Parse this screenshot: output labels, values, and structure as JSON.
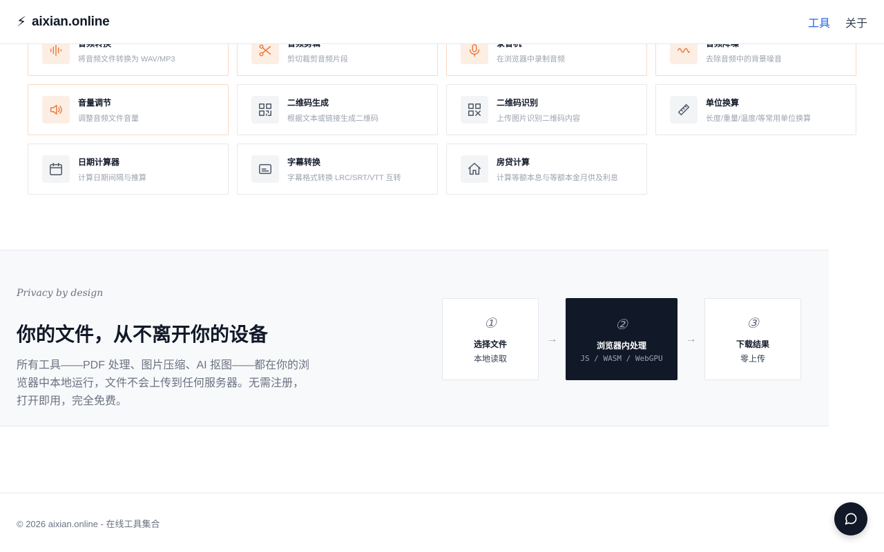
{
  "header": {
    "brand_icon": "⚡",
    "brand_name": "aixian.online",
    "nav": [
      {
        "label": "工具"
      },
      {
        "label": "关于"
      }
    ]
  },
  "tools": [
    {
      "title": "音频转换",
      "desc": "将音频文件转换为 WAV/MP3",
      "icon": "waveform-icon",
      "accent": "orange"
    },
    {
      "title": "音频剪辑",
      "desc": "剪切裁剪音频片段",
      "icon": "scissors-icon",
      "accent": "orange"
    },
    {
      "title": "录音机",
      "desc": "在浏览器中录制音频",
      "icon": "microphone-icon",
      "accent": "orange"
    },
    {
      "title": "音频降噪",
      "desc": "去除音频中的背景噪音",
      "icon": "wave-icon",
      "accent": "orange"
    },
    {
      "title": "音量调节",
      "desc": "调整音频文件音量",
      "icon": "speaker-icon",
      "accent": "orange"
    },
    {
      "title": "二维码生成",
      "desc": "根据文本或链接生成二维码",
      "icon": "qr-code-icon",
      "accent": "gray"
    },
    {
      "title": "二维码识别",
      "desc": "上传图片识别二维码内容",
      "icon": "qr-scan-icon",
      "accent": "gray"
    },
    {
      "title": "单位换算",
      "desc": "长度/重量/温度/等常用单位换算",
      "icon": "ruler-icon",
      "accent": "gray"
    },
    {
      "title": "日期计算器",
      "desc": "计算日期间隔与推算",
      "icon": "calendar-icon",
      "accent": "gray"
    },
    {
      "title": "字幕转换",
      "desc": "字幕格式转换 LRC/SRT/VTT 互转",
      "icon": "subtitles-icon",
      "accent": "gray"
    },
    {
      "title": "房贷计算",
      "desc": "计算等额本息与等额本金月供及利息",
      "icon": "home-icon",
      "accent": "gray"
    }
  ],
  "privacy": {
    "tag": "Privacy by design",
    "title": "你的文件，从不离开你的设备",
    "desc": "所有工具——PDF 处理、图片压缩、AI 抠图——都在你的浏览器中本地运行，文件不会上传到任何服务器。无需注册，打开即用，完全免费。",
    "steps": [
      {
        "num": "①",
        "label": "选择文件",
        "sub": "本地读取"
      },
      {
        "num": "②",
        "label": "浏览器内处理",
        "sub": "JS / WASM / WebGPU"
      },
      {
        "num": "③",
        "label": "下载结果",
        "sub": "零上传"
      }
    ],
    "arrow": "→"
  },
  "footer": {
    "copyright": "© 2026 aixian.online - 在线工具集合"
  }
}
